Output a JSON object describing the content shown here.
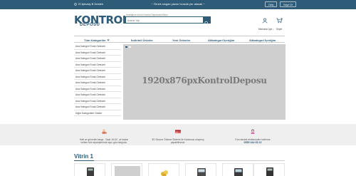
{
  "topbar": {
    "left_label": "İ3 İşlevsiy B Destek",
    "center_text": "~ Örnek slogan yazısı burada yer alacak ~",
    "buttons": [
      "Giriş",
      "Kayıt Ol"
    ]
  },
  "header": {
    "logo_main": "KONTROL",
    "logo_sub": "DEPOSU",
    "search_hint": "Aradığınız ürünü Kontrol Deposuda bulun",
    "search_placeholder": "Arama Yap",
    "account_label": "Merhaba Üye ↓",
    "cart_label": "Sepet",
    "cart_count": "0"
  },
  "nav": {
    "items": [
      "Tüm Kategoriler",
      "İndirimli Ürünler",
      "Yeni Gelenler",
      "Altkategori İçeriğim",
      "Altkategori İçeriğim"
    ]
  },
  "sidebar": {
    "items": [
      "Ana Kategori Sıralı Gelecek",
      "Ana Kategori Sıralı Gelecek",
      "Ana Kategori Sıralı Gelecek",
      "Ana Kategori Sıralı Gelecek",
      "Ana Kategori Sıralı Gelecek",
      "Ana Kategori Sıralı Gelecek",
      "Ana Kategori Sıralı Gelecek",
      "Ana Kategori Sıralı Gelecek",
      "Ana Kategori Sıralı Gelecek",
      "Ana Kategori Sıralı Gelecek",
      "Ana Kategori Sıralı Gelecek",
      "Diğer Kategorileri Göster"
    ]
  },
  "slider": {
    "placeholder": "1920x876pxKontrolDeposu"
  },
  "info": {
    "items": [
      {
        "line1": "Hafi ve güvenilir kargo . Saat 15:00 ' ye kadar",
        "line2": "verilen tüm siparişlerinde aynı gün kargoda."
      },
      {
        "line1": "3D Secure Ödeme Sistemi ile Kartanıza oluşmuş",
        "line2": "yapabilirsiniz."
      },
      {
        "line1": "Tüm destek ekibimizden hattımız:",
        "line2": "0555 444 33 22"
      }
    ]
  },
  "vitrin": {
    "title": "Vitrin 1"
  },
  "colors": {
    "brand": "#2e5b78",
    "slider_bg": "#cfcfcf",
    "band_bg": "#efefef"
  }
}
